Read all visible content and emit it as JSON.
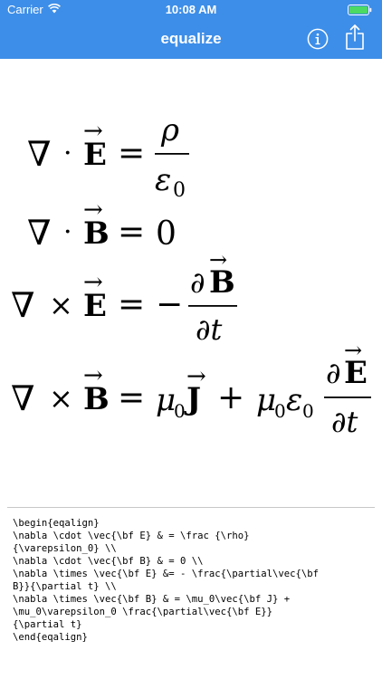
{
  "status_bar": {
    "carrier": "Carrier",
    "time": "10:08 AM",
    "wifi_icon": "wifi-icon",
    "battery_icon": "battery-icon",
    "battery_color": "#4cd964"
  },
  "nav": {
    "title": "equalize",
    "background_color": "#3d8ee8",
    "info_icon": "info-circle-icon",
    "share_icon": "share-icon"
  },
  "equations": {
    "eq1": {
      "lhs_op": "·",
      "lhs_field": "E",
      "numerator": "ρ",
      "denominator_symbol": "ε",
      "denominator_sub": "0"
    },
    "eq2": {
      "lhs_op": "·",
      "lhs_field": "B",
      "rhs": "0"
    },
    "eq3": {
      "lhs_op": "×",
      "lhs_field": "E",
      "minus": "−",
      "numerator_partial": "∂",
      "numerator_field": "B",
      "denominator": "∂t"
    },
    "eq4": {
      "lhs_op": "×",
      "lhs_field": "B",
      "mu": "μ",
      "sub0": "0",
      "J": "J",
      "plus": "+",
      "epsilon": "ε",
      "numerator_partial": "∂",
      "numerator_field": "E",
      "denominator": "∂t"
    },
    "nabla": "∇",
    "equals": "=",
    "arrow": "→"
  },
  "source": {
    "lines": [
      "\\begin{eqalign}",
      "\\nabla \\cdot \\vec{\\bf E} & = \\frac {\\rho}",
      "{\\varepsilon_0} \\\\",
      "\\nabla \\cdot \\vec{\\bf B} & = 0 \\\\",
      "\\nabla \\times \\vec{\\bf E} &= - \\frac{\\partial\\vec{\\bf",
      "B}}{\\partial t} \\\\",
      "\\nabla \\times \\vec{\\bf B} & = \\mu_0\\vec{\\bf J} +",
      "\\mu_0\\varepsilon_0 \\frac{\\partial\\vec{\\bf E}}",
      "{\\partial t}",
      "\\end{eqalign}"
    ]
  }
}
